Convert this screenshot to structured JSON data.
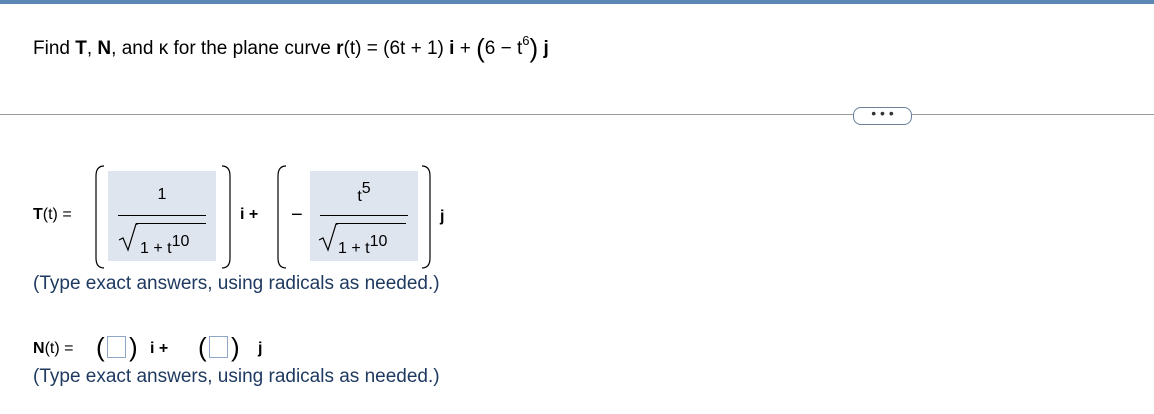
{
  "question": {
    "prefix": "Find ",
    "T": "T",
    "comma1": ", ",
    "N": "N",
    "and": ", and ",
    "kappa": "κ",
    "middle": " for the plane curve ",
    "r": "r",
    "r_arg": "(t) = (6t + 1) ",
    "i": "i",
    "plus": " + ",
    "paren_open": "(",
    "six_minus": "6 − t",
    "exp": "6",
    "paren_close": ")",
    "j": "j"
  },
  "more_button": "• • •",
  "T_row": {
    "label": "T",
    "label_tail": "(t) =",
    "i_label": "i +",
    "j_label": "j",
    "first_num": "1",
    "first_den_base": "1 + t",
    "first_den_exp": "10",
    "second_sign": "−",
    "second_num_base": "t",
    "second_num_exp": "5",
    "second_den_base": "1 + t",
    "second_den_exp": "10"
  },
  "note1": "(Type exact answers, using radicals as needed.)",
  "N_row": {
    "label": "N",
    "label_tail": "(t) =",
    "i_label": "i +",
    "j_label": "j",
    "input1_value": "",
    "input2_value": ""
  },
  "note2": "(Type exact answers, using radicals as needed.)"
}
